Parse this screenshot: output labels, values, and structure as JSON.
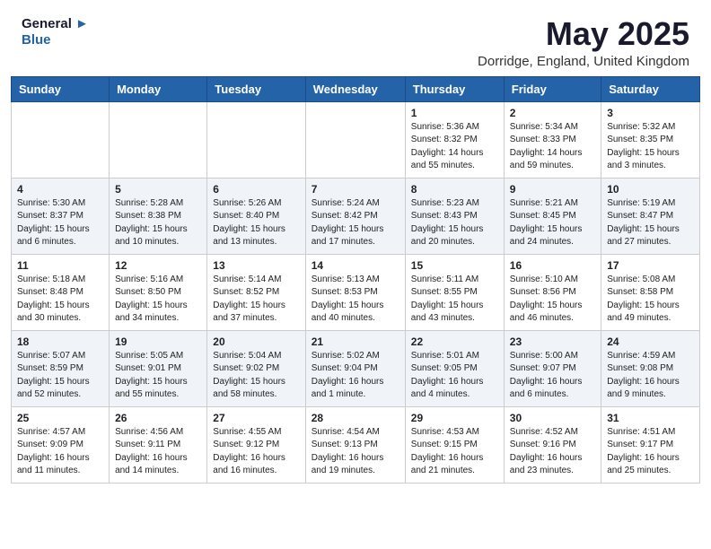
{
  "header": {
    "logo_line1": "General",
    "logo_line2": "Blue",
    "month_year": "May 2025",
    "location": "Dorridge, England, United Kingdom"
  },
  "weekdays": [
    "Sunday",
    "Monday",
    "Tuesday",
    "Wednesday",
    "Thursday",
    "Friday",
    "Saturday"
  ],
  "weeks": [
    [
      {
        "day": "",
        "content": ""
      },
      {
        "day": "",
        "content": ""
      },
      {
        "day": "",
        "content": ""
      },
      {
        "day": "",
        "content": ""
      },
      {
        "day": "1",
        "content": "Sunrise: 5:36 AM\nSunset: 8:32 PM\nDaylight: 14 hours\nand 55 minutes."
      },
      {
        "day": "2",
        "content": "Sunrise: 5:34 AM\nSunset: 8:33 PM\nDaylight: 14 hours\nand 59 minutes."
      },
      {
        "day": "3",
        "content": "Sunrise: 5:32 AM\nSunset: 8:35 PM\nDaylight: 15 hours\nand 3 minutes."
      }
    ],
    [
      {
        "day": "4",
        "content": "Sunrise: 5:30 AM\nSunset: 8:37 PM\nDaylight: 15 hours\nand 6 minutes."
      },
      {
        "day": "5",
        "content": "Sunrise: 5:28 AM\nSunset: 8:38 PM\nDaylight: 15 hours\nand 10 minutes."
      },
      {
        "day": "6",
        "content": "Sunrise: 5:26 AM\nSunset: 8:40 PM\nDaylight: 15 hours\nand 13 minutes."
      },
      {
        "day": "7",
        "content": "Sunrise: 5:24 AM\nSunset: 8:42 PM\nDaylight: 15 hours\nand 17 minutes."
      },
      {
        "day": "8",
        "content": "Sunrise: 5:23 AM\nSunset: 8:43 PM\nDaylight: 15 hours\nand 20 minutes."
      },
      {
        "day": "9",
        "content": "Sunrise: 5:21 AM\nSunset: 8:45 PM\nDaylight: 15 hours\nand 24 minutes."
      },
      {
        "day": "10",
        "content": "Sunrise: 5:19 AM\nSunset: 8:47 PM\nDaylight: 15 hours\nand 27 minutes."
      }
    ],
    [
      {
        "day": "11",
        "content": "Sunrise: 5:18 AM\nSunset: 8:48 PM\nDaylight: 15 hours\nand 30 minutes."
      },
      {
        "day": "12",
        "content": "Sunrise: 5:16 AM\nSunset: 8:50 PM\nDaylight: 15 hours\nand 34 minutes."
      },
      {
        "day": "13",
        "content": "Sunrise: 5:14 AM\nSunset: 8:52 PM\nDaylight: 15 hours\nand 37 minutes."
      },
      {
        "day": "14",
        "content": "Sunrise: 5:13 AM\nSunset: 8:53 PM\nDaylight: 15 hours\nand 40 minutes."
      },
      {
        "day": "15",
        "content": "Sunrise: 5:11 AM\nSunset: 8:55 PM\nDaylight: 15 hours\nand 43 minutes."
      },
      {
        "day": "16",
        "content": "Sunrise: 5:10 AM\nSunset: 8:56 PM\nDaylight: 15 hours\nand 46 minutes."
      },
      {
        "day": "17",
        "content": "Sunrise: 5:08 AM\nSunset: 8:58 PM\nDaylight: 15 hours\nand 49 minutes."
      }
    ],
    [
      {
        "day": "18",
        "content": "Sunrise: 5:07 AM\nSunset: 8:59 PM\nDaylight: 15 hours\nand 52 minutes."
      },
      {
        "day": "19",
        "content": "Sunrise: 5:05 AM\nSunset: 9:01 PM\nDaylight: 15 hours\nand 55 minutes."
      },
      {
        "day": "20",
        "content": "Sunrise: 5:04 AM\nSunset: 9:02 PM\nDaylight: 15 hours\nand 58 minutes."
      },
      {
        "day": "21",
        "content": "Sunrise: 5:02 AM\nSunset: 9:04 PM\nDaylight: 16 hours\nand 1 minute."
      },
      {
        "day": "22",
        "content": "Sunrise: 5:01 AM\nSunset: 9:05 PM\nDaylight: 16 hours\nand 4 minutes."
      },
      {
        "day": "23",
        "content": "Sunrise: 5:00 AM\nSunset: 9:07 PM\nDaylight: 16 hours\nand 6 minutes."
      },
      {
        "day": "24",
        "content": "Sunrise: 4:59 AM\nSunset: 9:08 PM\nDaylight: 16 hours\nand 9 minutes."
      }
    ],
    [
      {
        "day": "25",
        "content": "Sunrise: 4:57 AM\nSunset: 9:09 PM\nDaylight: 16 hours\nand 11 minutes."
      },
      {
        "day": "26",
        "content": "Sunrise: 4:56 AM\nSunset: 9:11 PM\nDaylight: 16 hours\nand 14 minutes."
      },
      {
        "day": "27",
        "content": "Sunrise: 4:55 AM\nSunset: 9:12 PM\nDaylight: 16 hours\nand 16 minutes."
      },
      {
        "day": "28",
        "content": "Sunrise: 4:54 AM\nSunset: 9:13 PM\nDaylight: 16 hours\nand 19 minutes."
      },
      {
        "day": "29",
        "content": "Sunrise: 4:53 AM\nSunset: 9:15 PM\nDaylight: 16 hours\nand 21 minutes."
      },
      {
        "day": "30",
        "content": "Sunrise: 4:52 AM\nSunset: 9:16 PM\nDaylight: 16 hours\nand 23 minutes."
      },
      {
        "day": "31",
        "content": "Sunrise: 4:51 AM\nSunset: 9:17 PM\nDaylight: 16 hours\nand 25 minutes."
      }
    ]
  ]
}
